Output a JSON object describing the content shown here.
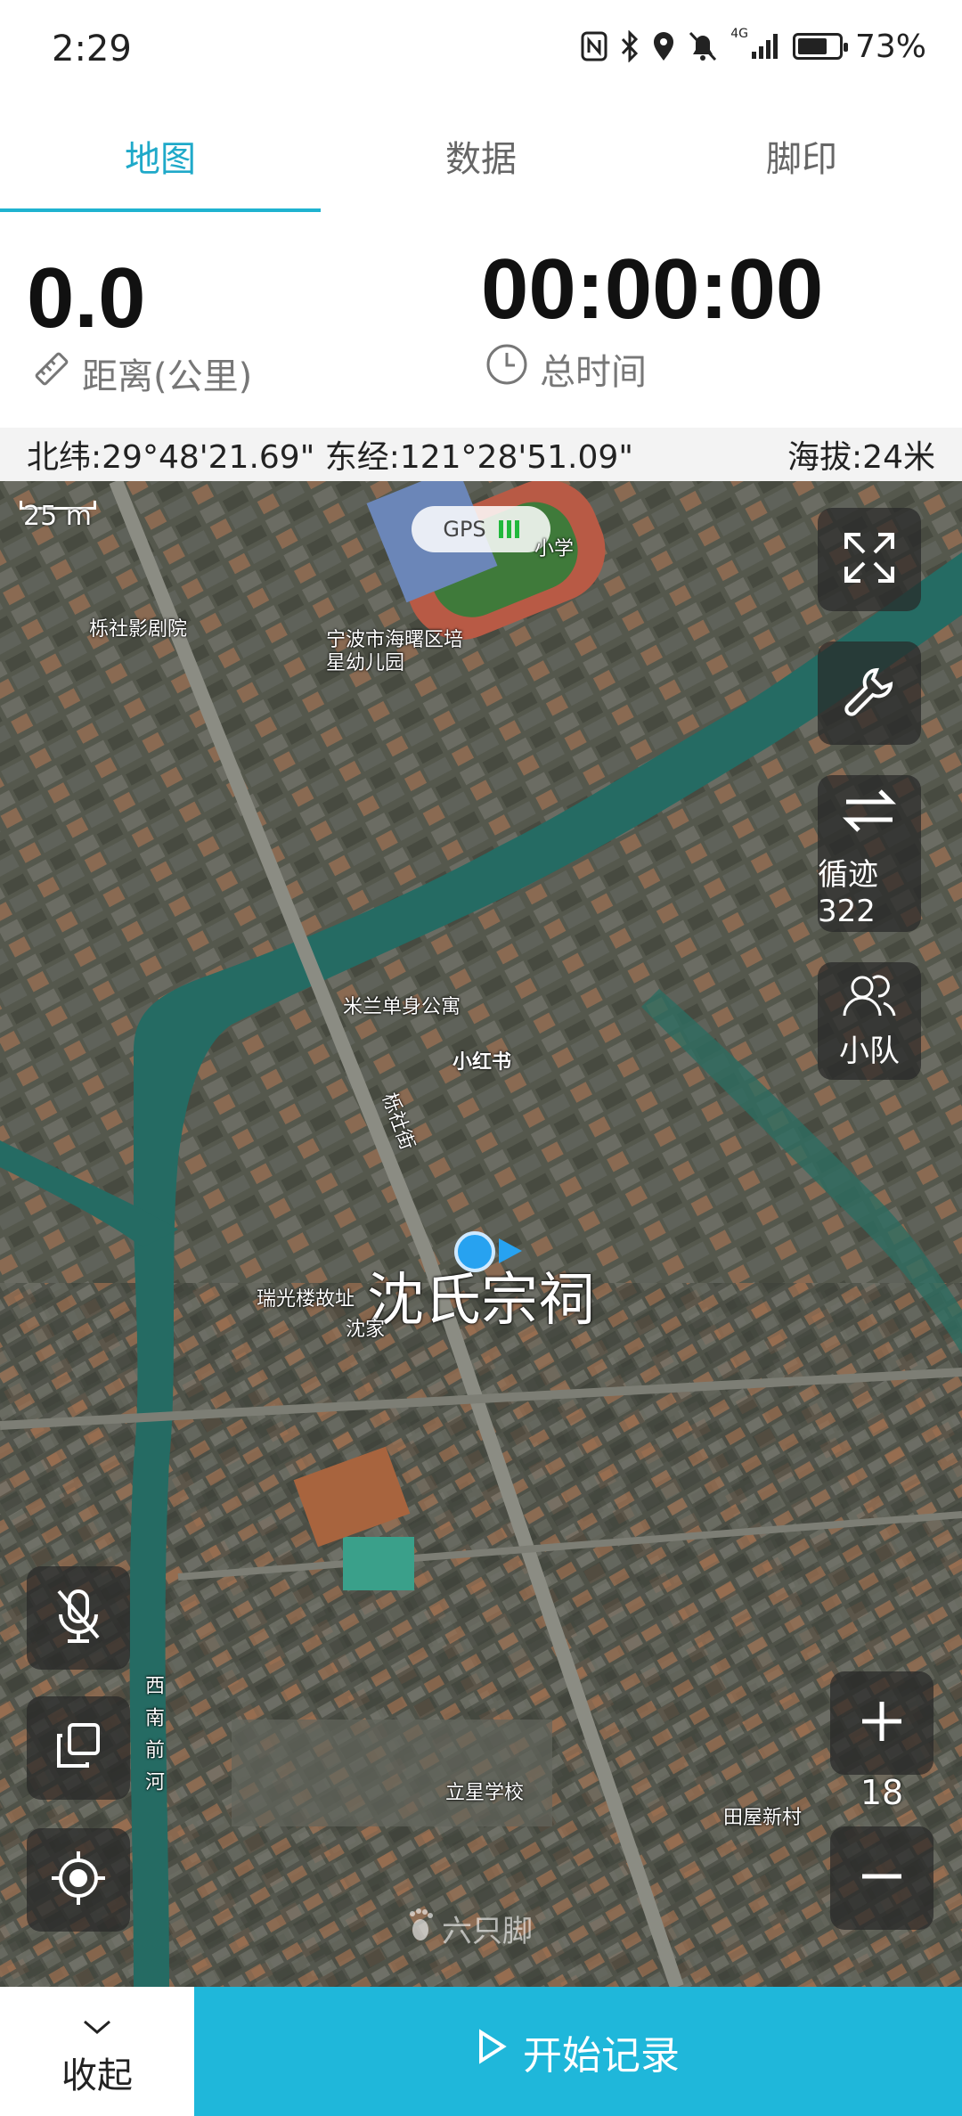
{
  "status": {
    "time": "2:29",
    "network": "4G",
    "battery": "73%",
    "battery_level": 0.73
  },
  "tabs": [
    {
      "label": "地图",
      "active": true
    },
    {
      "label": "数据",
      "active": false
    },
    {
      "label": "脚印",
      "active": false
    }
  ],
  "stats": {
    "distance_value": "0.0",
    "distance_label": "距离(公里)",
    "time_value": "00:00:00",
    "time_label": "总时间"
  },
  "coords": {
    "latlng": "北纬:29°48'21.69\" 东经:121°28'51.09\"",
    "altitude": "海拔:24米"
  },
  "map": {
    "scale": "25 m",
    "gps_label": "GPS",
    "labels": {
      "school_top": "小学",
      "cinema": "栎社影剧院",
      "kindergarten_1": "宁波市海曙区培",
      "kindergarten_2": "星幼儿园",
      "studio": "米兰单身公寓",
      "xiaohongshu": "小红书",
      "street": "栎社街",
      "main_poi": "沈氏宗祠",
      "ruiguang": "瑞光楼故址",
      "shenjia": "沈家",
      "lixing": "立星学校",
      "tianwu": "田屋新村",
      "river": "西南前河"
    },
    "tracks_label": "循迹322",
    "team_label": "小队",
    "zoom_level": "18",
    "watermark": "六只脚"
  },
  "icons": {
    "fullscreen": "fullscreen-icon",
    "tools": "wrench-icon",
    "tracks": "swap-arrows-icon",
    "team": "team-icon",
    "mic": "mic-off-icon",
    "layers": "copy-layers-icon",
    "locate": "locate-icon",
    "zoom_in": "plus-icon",
    "zoom_out": "minus-icon"
  },
  "bottom": {
    "collapse_label": "收起",
    "start_label": "开始记录"
  },
  "colors": {
    "accent": "#1fb7da",
    "gps_ok": "#21b83c"
  }
}
